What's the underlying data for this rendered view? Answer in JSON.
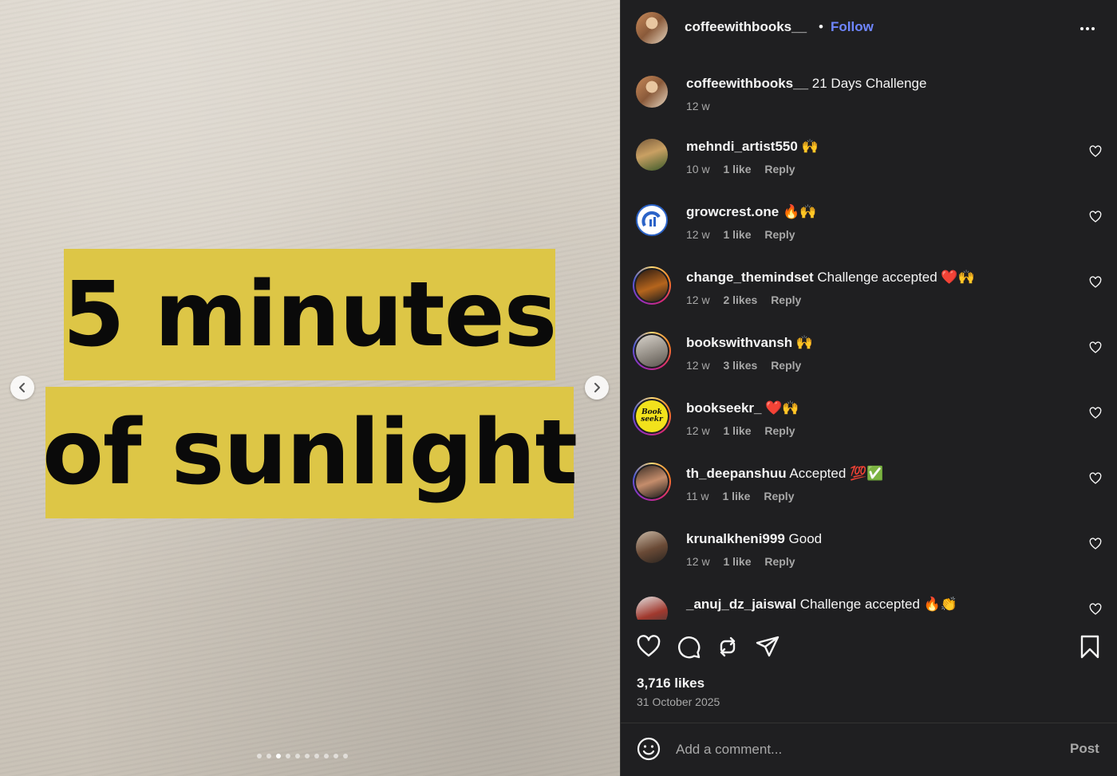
{
  "post_image": {
    "line1": "5 minutes",
    "line2": "of sunlight",
    "carousel_dots": 10,
    "active_dot": 2
  },
  "header": {
    "username": "coffeewithbooks__",
    "separator": "•",
    "follow_label": "Follow"
  },
  "caption": {
    "username": "coffeewithbooks__",
    "text": "21 Days Challenge",
    "time": "12 w"
  },
  "comments": [
    {
      "username": "mehndi_artist550",
      "text": "🙌",
      "time": "10 w",
      "likes": "1 like",
      "reply": "Reply"
    },
    {
      "username": "growcrest.one",
      "text": "🔥🙌",
      "time": "12 w",
      "likes": "1 like",
      "reply": "Reply"
    },
    {
      "username": "change_themindset",
      "text": "Challenge accepted ❤️🙌",
      "time": "12 w",
      "likes": "2 likes",
      "reply": "Reply"
    },
    {
      "username": "bookswithvansh",
      "text": "🙌",
      "time": "12 w",
      "likes": "3 likes",
      "reply": "Reply"
    },
    {
      "username": "bookseekr_",
      "text": "❤️🙌",
      "time": "12 w",
      "likes": "1 like",
      "reply": "Reply",
      "avatar_text": "Book seekr"
    },
    {
      "username": "th_deepanshuu",
      "text": "Accepted 💯✅",
      "time": "11 w",
      "likes": "1 like",
      "reply": "Reply"
    },
    {
      "username": "krunalkheni999",
      "text": "Good",
      "time": "12 w",
      "likes": "1 like",
      "reply": "Reply"
    },
    {
      "username": "_anuj_dz_jaiswal",
      "text": "Challenge accepted 🔥👏",
      "time": "",
      "likes": "",
      "reply": ""
    }
  ],
  "stats": {
    "likes": "3,716 likes",
    "date": "31 October 2025"
  },
  "composer": {
    "placeholder": "Add a comment...",
    "post_label": "Post"
  },
  "colors": {
    "panel_bg": "#1f1f21",
    "follow": "#6f86ff",
    "highlight": "#ddc646",
    "muted": "#a8a8a8"
  }
}
